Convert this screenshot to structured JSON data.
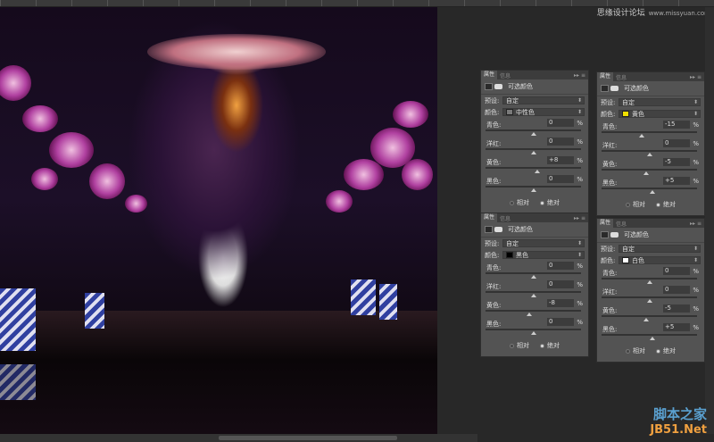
{
  "watermark": {
    "text": "思缘设计论坛",
    "url": "www.missyuan.com"
  },
  "logo": {
    "line1": "脚本之家",
    "line2": "JB51.Net"
  },
  "panels": [
    {
      "tabs": [
        "属性",
        "信息"
      ],
      "title": "可选颜色",
      "preset_label": "预设:",
      "preset": "自定",
      "color_label": "颜色:",
      "color": "中性色",
      "swatch": "#7a7a7a",
      "sliders": [
        {
          "name": "青色:",
          "value": "0",
          "pos": 0.5
        },
        {
          "name": "洋红:",
          "value": "0",
          "pos": 0.5
        },
        {
          "name": "黄色:",
          "value": "+8",
          "pos": 0.54
        },
        {
          "name": "黑色:",
          "value": "0",
          "pos": 0.5
        }
      ],
      "relative": "相对",
      "absolute": "绝对",
      "mode": "absolute"
    },
    {
      "tabs": [
        "属性",
        "信息"
      ],
      "title": "可选颜色",
      "preset_label": "预设:",
      "preset": "自定",
      "color_label": "颜色:",
      "color": "黄色",
      "swatch": "#f0e000",
      "sliders": [
        {
          "name": "青色:",
          "value": "-15",
          "pos": 0.42
        },
        {
          "name": "洋红:",
          "value": "0",
          "pos": 0.5
        },
        {
          "name": "黄色:",
          "value": "-5",
          "pos": 0.47
        },
        {
          "name": "黑色:",
          "value": "+5",
          "pos": 0.53
        }
      ],
      "relative": "相对",
      "absolute": "绝对",
      "mode": "absolute"
    },
    {
      "tabs": [
        "属性",
        "信息"
      ],
      "title": "可选颜色",
      "preset_label": "预设:",
      "preset": "自定",
      "color_label": "颜色:",
      "color": "黑色",
      "swatch": "#000000",
      "sliders": [
        {
          "name": "青色:",
          "value": "0",
          "pos": 0.5
        },
        {
          "name": "洋红:",
          "value": "0",
          "pos": 0.5
        },
        {
          "name": "黄色:",
          "value": "-8",
          "pos": 0.46
        },
        {
          "name": "黑色:",
          "value": "0",
          "pos": 0.5
        }
      ],
      "relative": "相对",
      "absolute": "绝对",
      "mode": "absolute"
    },
    {
      "tabs": [
        "属性",
        "信息"
      ],
      "title": "可选颜色",
      "preset_label": "预设:",
      "preset": "自定",
      "color_label": "颜色:",
      "color": "白色",
      "swatch": "#ffffff",
      "sliders": [
        {
          "name": "青色:",
          "value": "0",
          "pos": 0.5
        },
        {
          "name": "洋红:",
          "value": "0",
          "pos": 0.5
        },
        {
          "name": "黄色:",
          "value": "-5",
          "pos": 0.47
        },
        {
          "name": "黑色:",
          "value": "+5",
          "pos": 0.53
        }
      ],
      "relative": "相对",
      "absolute": "绝对",
      "mode": "absolute"
    }
  ]
}
